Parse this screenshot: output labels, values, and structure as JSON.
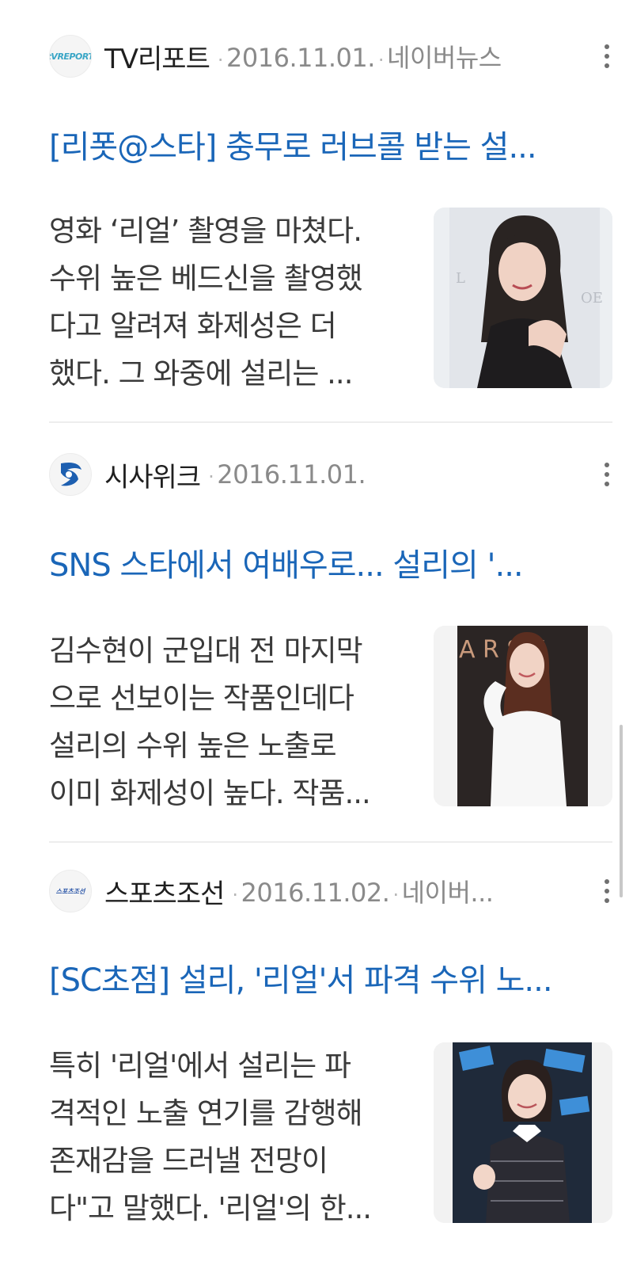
{
  "articles": [
    {
      "press": "TV리포트",
      "logo_text": "tVREPORT",
      "date": "2016.11.01.",
      "source": "네이버뉴스",
      "headline": "[리폿@스타] 충무로 러브콜 받는 설...",
      "snippet": [
        "영화 ‘리얼’ 촬영을 마쳤다.",
        "수위 높은 베드신을 촬영했",
        "다고 알려져 화제성은 더",
        "했다. 그 와중에 설리는 ..."
      ],
      "more_icon": "more-vertical-icon"
    },
    {
      "press": "시사위크",
      "logo_text": "",
      "date": "2016.11.01.",
      "source": "",
      "headline": "SNS 스타에서 여배우로... 설리의 '...",
      "snippet": [
        "김수현이 군입대 전 마지막",
        "으로 선보이는 작품인데다",
        "설리의 수위 높은 노출로",
        "이미 화제성이 높다. 작품..."
      ],
      "more_icon": "more-vertical-icon"
    },
    {
      "press": "스포츠조선",
      "logo_text": "스포츠조선",
      "date": "2016.11.02.",
      "source": "네이버...",
      "headline": "[SC초점] 설리, '리얼'서 파격 수위 노...",
      "snippet": [
        "특히 '리얼'에서 설리는 파",
        "격적인 노출 연기를 감행해",
        "존재감을 드러낼 전망이",
        "다\"고 말했다. '리얼'의 한..."
      ],
      "more_icon": "more-vertical-icon"
    }
  ],
  "colors": {
    "headline": "#1a66b8",
    "meta": "#8a8a8a",
    "body": "#3a3a3a",
    "press": "#1f1f1f"
  }
}
